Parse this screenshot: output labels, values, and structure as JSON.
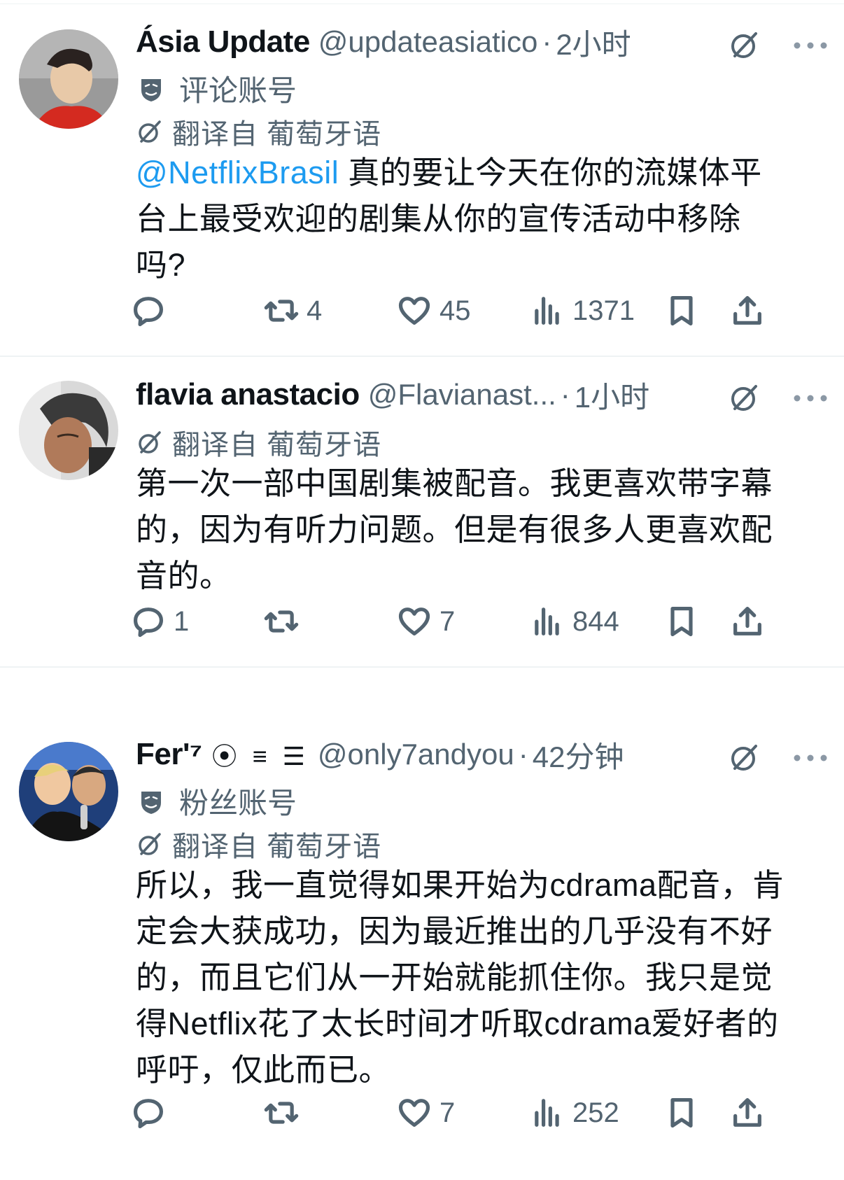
{
  "tweets": [
    {
      "name": "Ásia Update",
      "handle": "@updateasiatico",
      "time": "2小时",
      "badge": "评论账号",
      "translated": "翻译自 葡萄牙语",
      "mention": "@NetflixBrasil",
      "text": " 真的要让今天在你的流媒体平\n台上最受欢迎的剧集从你的宣传活动中移除\n吗?",
      "replies": "",
      "retweets": "4",
      "likes": "45",
      "views": "1371",
      "avatar_bg": "#8a8a8a",
      "avatar_accent": "#d42a20"
    },
    {
      "name": "flavia anastacio",
      "handle": "@Flavianast...",
      "time": "1小时",
      "translated": "翻译自 葡萄牙语",
      "text": "第一次一部中国剧集被配音。我更喜欢带字幕\n的，因为有听力问题。但是有很多人更喜欢配\n音的。",
      "replies": "1",
      "retweets": "",
      "likes": "7",
      "views": "844",
      "avatar_bg": "#d9d9d9",
      "avatar_accent": "#5a3a2a"
    },
    {
      "name": "Fer'⁷",
      "name_symbols": "⦿ ≡ ☰",
      "handle": "@only7andyou",
      "time": "42分钟",
      "badge": "粉丝账号",
      "translated": "翻译自 葡萄牙语",
      "text": "所以，我一直觉得如果开始为cdrama配音，肯\n定会大获成功，因为最近推出的几乎没有不好\n的，而且它们从一开始就能抓住你。我只是觉\n得Netflix花了太长时间才听取cdrama爱好者的\n呼吁，仅此而已。",
      "replies": "",
      "retweets": "",
      "likes": "7",
      "views": "252",
      "avatar_bg": "#2a5aa8",
      "avatar_accent": "#f0c8a0"
    }
  ],
  "colors": {
    "text": "#0f1419",
    "secondary": "#536471",
    "link": "#1d9bf0",
    "divider": "#eff3f4"
  }
}
